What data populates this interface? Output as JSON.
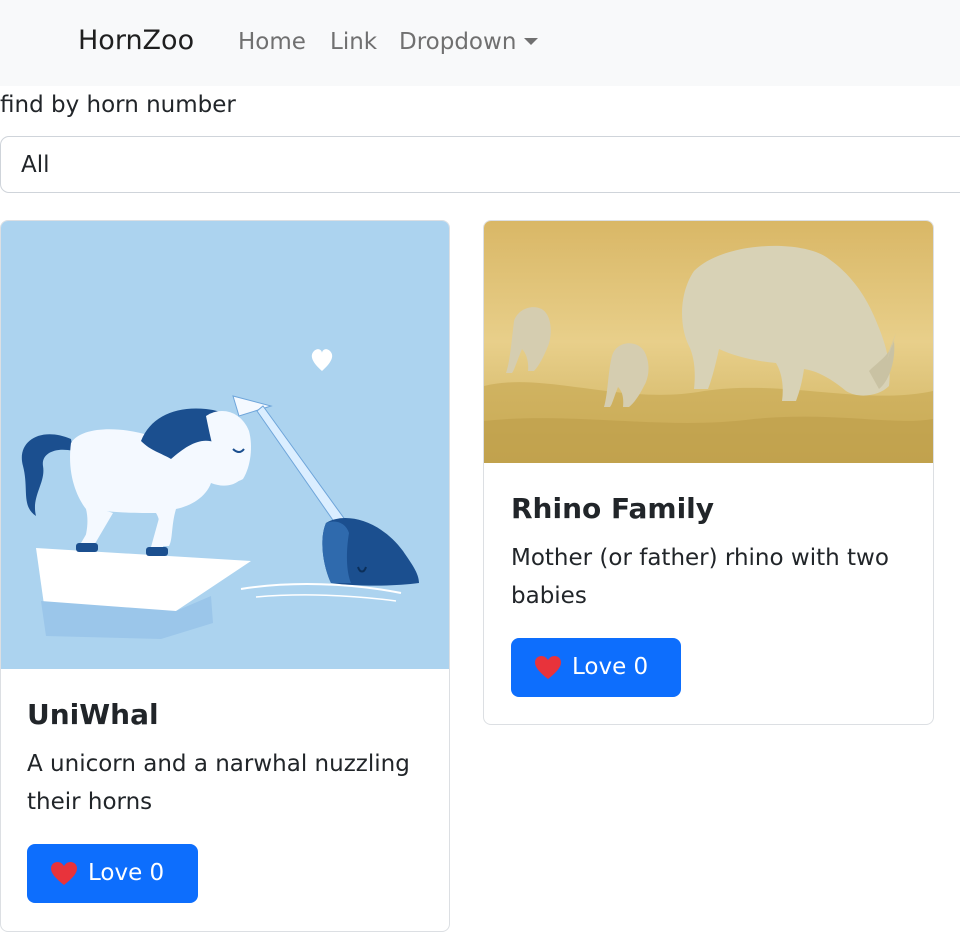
{
  "navbar": {
    "brand": "HornZoo",
    "links": [
      "Home",
      "Link",
      "Dropdown"
    ]
  },
  "filter": {
    "label": "find by horn number",
    "selected": "All"
  },
  "cards": [
    {
      "title": "UniWhal",
      "description": "A unicorn and a narwhal nuzzling their horns",
      "button_label": "Love 0"
    },
    {
      "title": "Rhino Family",
      "description": "Mother (or father) rhino with two babies",
      "button_label": "Love 0"
    }
  ],
  "colors": {
    "primary": "#0d6efd",
    "heart": "#e8333b",
    "navbar_bg": "#f8f9fa"
  }
}
